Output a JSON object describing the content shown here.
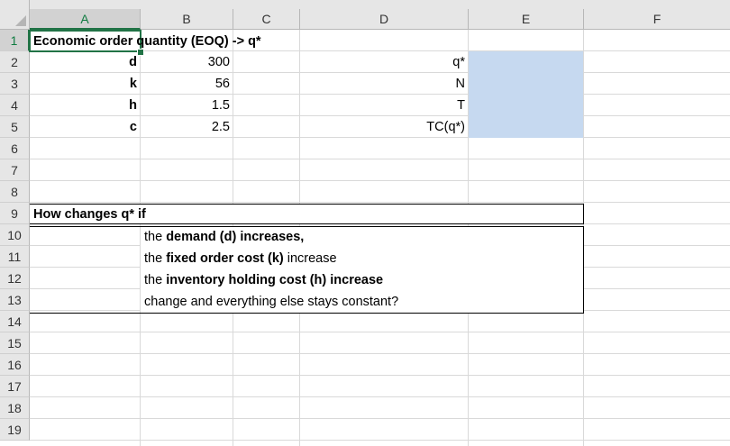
{
  "columns": [
    "A",
    "B",
    "C",
    "D",
    "E",
    "F"
  ],
  "rows": [
    "1",
    "2",
    "3",
    "4",
    "5",
    "6",
    "7",
    "8",
    "9",
    "10",
    "11",
    "12",
    "13",
    "14",
    "15",
    "16",
    "17",
    "18",
    "19"
  ],
  "a1": "Economic order quantity (EOQ) -> q*",
  "params": [
    {
      "label": "d",
      "value": "300"
    },
    {
      "label": "k",
      "value": "56"
    },
    {
      "label": "h",
      "value": "1.5"
    },
    {
      "label": "c",
      "value": "2.5"
    }
  ],
  "outputs": [
    "q*",
    "N",
    "T",
    "TC(q*)"
  ],
  "a9": "How changes q* if",
  "b10_1": "the ",
  "b10_2": "demand (d) increases,",
  "b11_1": "the ",
  "b11_2": "fixed order cost (k)",
  "b11_3": " increase",
  "b12_1": "the ",
  "b12_2": "inventory holding cost (h) increase",
  "b13": "change and everything else stays constant?",
  "colors": {
    "output_fill": "#c6d9f0",
    "selection": "#217346"
  }
}
